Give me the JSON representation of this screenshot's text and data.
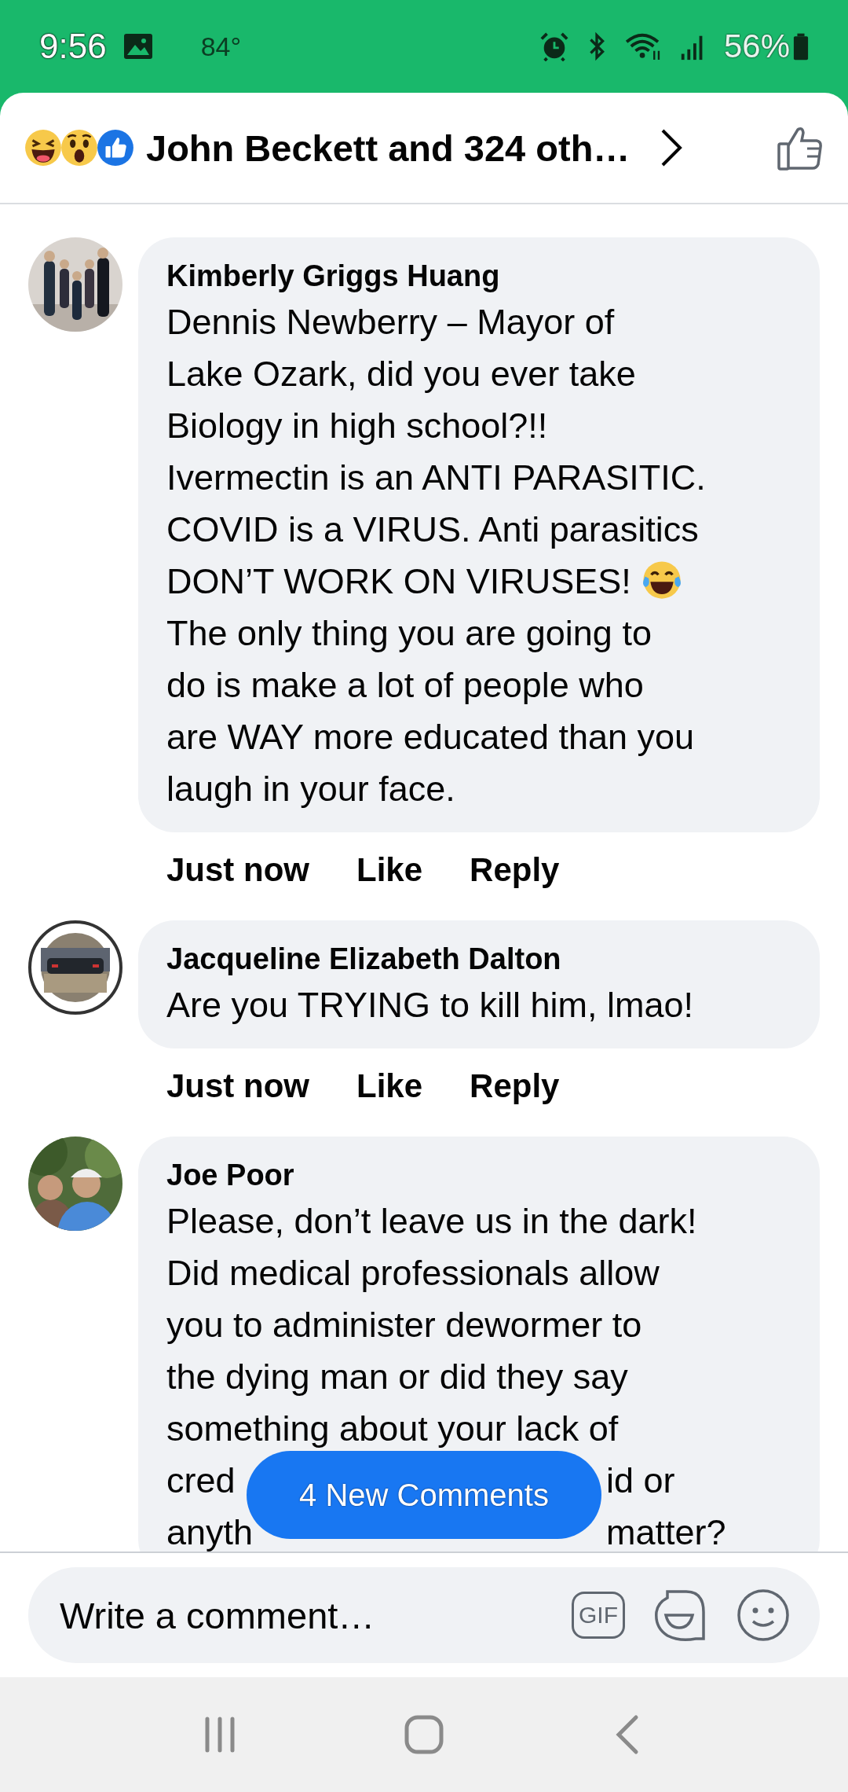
{
  "status_bar": {
    "time": "9:56",
    "temperature": "84°",
    "battery": "56%"
  },
  "header": {
    "reactions": [
      {
        "kind": "haha"
      },
      {
        "kind": "wow"
      },
      {
        "kind": "like"
      }
    ],
    "title": "John Beckett and 324 oth…"
  },
  "comments": [
    {
      "author": "Kimberly Griggs Huang",
      "lines": [
        "Dennis Newberry –  Mayor of",
        "Lake Ozark, did you ever take",
        "Biology in high school?!!",
        "Ivermectin is an ANTI PARASITIC.",
        "COVID is a VIRUS. Anti parasitics",
        {
          "text": "DON’T WORK ON VIRUSES!",
          "icon": {
            "kind": "laugh"
          }
        },
        "The only thing you are going to",
        "do is make a lot of people who",
        "are WAY more educated than you",
        "laugh in your face."
      ],
      "time": "Just now",
      "actions": [
        "Like",
        "Reply"
      ]
    },
    {
      "author": "Jacqueline Elizabeth Dalton",
      "lines": [
        "Are you TRYING to kill him, lmao!"
      ],
      "time": "Just now",
      "actions": [
        "Like",
        "Reply"
      ]
    },
    {
      "author": "Joe Poor",
      "lines": [
        "Please, don’t leave us in the dark!",
        "Did medical professionals allow",
        "you to administer dewormer to",
        "the dying man or did they say",
        "something about your lack of",
        {
          "text": "cred",
          "after": "id or"
        },
        {
          "text": "anyth",
          "after": "matter?"
        }
      ]
    }
  ],
  "new_comments_button": "4 New Comments",
  "composer": {
    "placeholder": "Write a comment…",
    "gif": "GIF"
  }
}
